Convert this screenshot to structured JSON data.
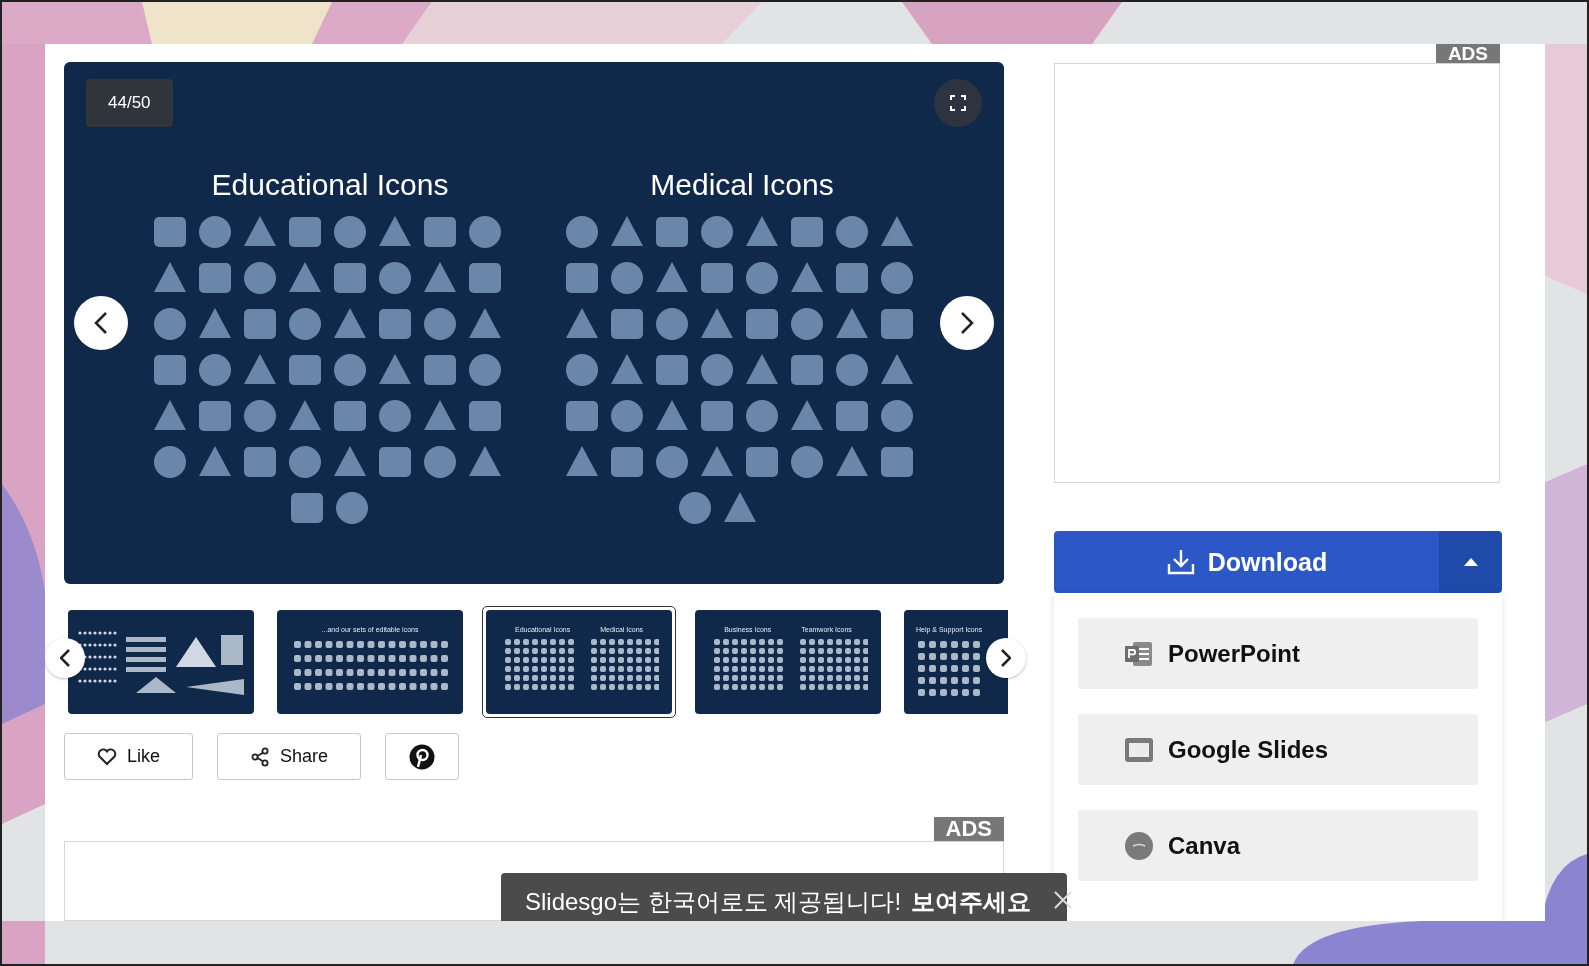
{
  "slide": {
    "counter": "44/50",
    "sets": [
      {
        "title": "Educational Icons"
      },
      {
        "title": "Medical Icons"
      }
    ]
  },
  "thumbnails": [
    {
      "kind": "charts",
      "selected": false
    },
    {
      "kind": "one_set",
      "titles": [
        "...and our sets of editable icons"
      ],
      "selected": false
    },
    {
      "kind": "two_sets",
      "titles": [
        "Educational Icons",
        "Medical Icons"
      ],
      "selected": true
    },
    {
      "kind": "two_sets",
      "titles": [
        "Business Icons",
        "Teamwork Icons"
      ],
      "selected": false
    },
    {
      "kind": "one_set_left",
      "titles": [
        "Help & Support Icons"
      ],
      "selected": false
    }
  ],
  "actions": [
    {
      "kind": "like",
      "label": "Like"
    },
    {
      "kind": "share",
      "label": "Share"
    },
    {
      "kind": "pinterest"
    }
  ],
  "bottom_ad": {
    "label": "ADS"
  },
  "sidebar_ad": {
    "label": "ADS"
  },
  "download": {
    "label": "Download",
    "expanded": true,
    "options": [
      {
        "kind": "powerpoint",
        "label": "PowerPoint"
      },
      {
        "kind": "google_slides",
        "label": "Google Slides"
      },
      {
        "kind": "canva",
        "label": "Canva"
      }
    ]
  },
  "toast": {
    "text": "Slidesgo는 한국어로도 제공됩니다!",
    "action": "보여주세요"
  }
}
